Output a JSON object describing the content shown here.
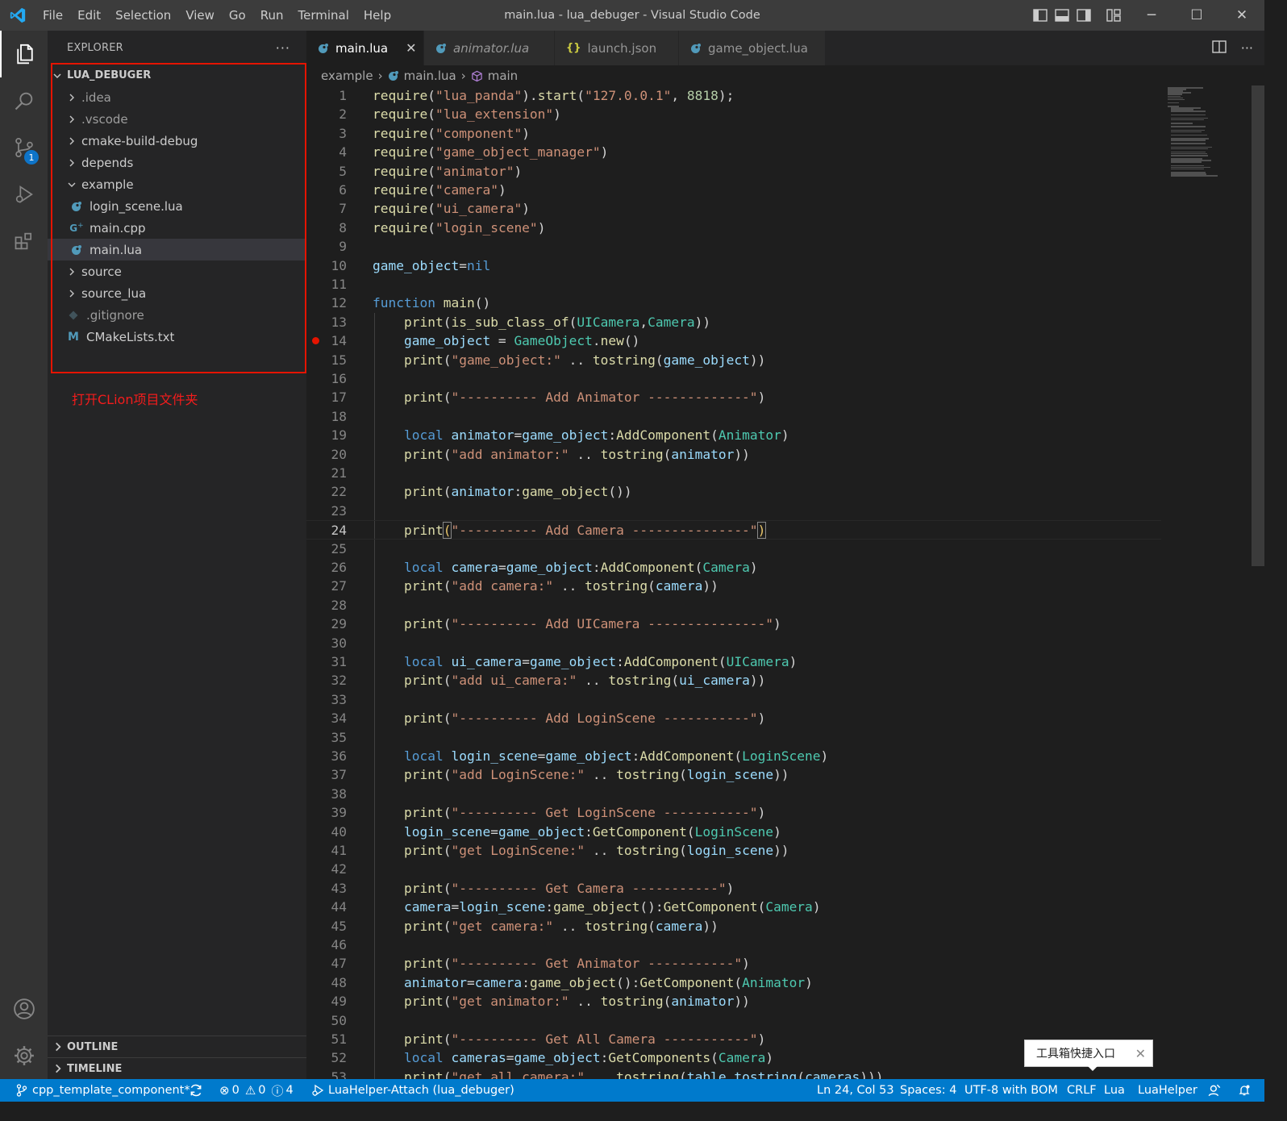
{
  "window": {
    "title": "main.lua - lua_debuger - Visual Studio Code",
    "menu": [
      "File",
      "Edit",
      "Selection",
      "View",
      "Go",
      "Run",
      "Terminal",
      "Help"
    ],
    "controls": {
      "minimize": "─",
      "maximize": "☐",
      "close": "✕"
    }
  },
  "activity_bar": {
    "scm_badge": "1"
  },
  "sidebar": {
    "title": "EXPLORER",
    "more": "···",
    "root": "LUA_DEBUGER",
    "items": [
      {
        "label": ".idea",
        "type": "folder",
        "depth": 1
      },
      {
        "label": ".vscode",
        "type": "folder",
        "depth": 1
      },
      {
        "label": "cmake-build-debug",
        "type": "folder",
        "depth": 1
      },
      {
        "label": "depends",
        "type": "folder",
        "depth": 1
      },
      {
        "label": "example",
        "type": "folder-open",
        "depth": 1
      },
      {
        "label": "login_scene.lua",
        "type": "lua",
        "depth": 2
      },
      {
        "label": "main.cpp",
        "type": "cpp",
        "depth": 2
      },
      {
        "label": "main.lua",
        "type": "lua",
        "depth": 2,
        "selected": true
      },
      {
        "label": "source",
        "type": "folder",
        "depth": 1
      },
      {
        "label": "source_lua",
        "type": "folder",
        "depth": 1
      },
      {
        "label": ".gitignore",
        "type": "git",
        "depth": 1
      },
      {
        "label": "CMakeLists.txt",
        "type": "cmake",
        "depth": 1
      }
    ],
    "annotation": "打开CLion项目文件夹",
    "outline": "OUTLINE",
    "timeline": "TIMELINE"
  },
  "tabs": [
    {
      "label": "main.lua",
      "active": true,
      "icon": "lua",
      "close": "✕"
    },
    {
      "label": "animator.lua",
      "italic": true,
      "icon": "lua"
    },
    {
      "label": "launch.json",
      "icon": "json"
    },
    {
      "label": "game_object.lua",
      "icon": "lua"
    }
  ],
  "breadcrumb": [
    "example",
    "main.lua",
    "main"
  ],
  "editor": {
    "current_line": 24,
    "breakpoint_line": 14,
    "lines": [
      [
        [
          "f",
          "require"
        ],
        [
          "w",
          "("
        ],
        [
          "s",
          "\"lua_panda\""
        ],
        [
          "w",
          ")."
        ],
        [
          "f",
          "start"
        ],
        [
          "w",
          "("
        ],
        [
          "s",
          "\"127.0.0.1\""
        ],
        [
          "w",
          ", "
        ],
        [
          "n",
          "8818"
        ],
        [
          "w",
          ");"
        ]
      ],
      [
        [
          "f",
          "require"
        ],
        [
          "w",
          "("
        ],
        [
          "s",
          "\"lua_extension\""
        ],
        [
          "w",
          ")"
        ]
      ],
      [
        [
          "f",
          "require"
        ],
        [
          "w",
          "("
        ],
        [
          "s",
          "\"component\""
        ],
        [
          "w",
          ")"
        ]
      ],
      [
        [
          "f",
          "require"
        ],
        [
          "w",
          "("
        ],
        [
          "s",
          "\"game_object_manager\""
        ],
        [
          "w",
          ")"
        ]
      ],
      [
        [
          "f",
          "require"
        ],
        [
          "w",
          "("
        ],
        [
          "s",
          "\"animator\""
        ],
        [
          "w",
          ")"
        ]
      ],
      [
        [
          "f",
          "require"
        ],
        [
          "w",
          "("
        ],
        [
          "s",
          "\"camera\""
        ],
        [
          "w",
          ")"
        ]
      ],
      [
        [
          "f",
          "require"
        ],
        [
          "w",
          "("
        ],
        [
          "s",
          "\"ui_camera\""
        ],
        [
          "w",
          ")"
        ]
      ],
      [
        [
          "f",
          "require"
        ],
        [
          "w",
          "("
        ],
        [
          "s",
          "\"login_scene\""
        ],
        [
          "w",
          ")"
        ]
      ],
      [],
      [
        [
          "v",
          "game_object"
        ],
        [
          "w",
          "="
        ],
        [
          "k",
          "nil"
        ]
      ],
      [],
      [
        [
          "k",
          "function "
        ],
        [
          "f",
          "main"
        ],
        [
          "w",
          "()"
        ]
      ],
      [
        [
          "w",
          "    "
        ],
        [
          "f",
          "print"
        ],
        [
          "w",
          "("
        ],
        [
          "f",
          "is_sub_class_of"
        ],
        [
          "w",
          "("
        ],
        [
          "t",
          "UICamera"
        ],
        [
          "w",
          ","
        ],
        [
          "t",
          "Camera"
        ],
        [
          "w",
          "))"
        ]
      ],
      [
        [
          "w",
          "    "
        ],
        [
          "v",
          "game_object"
        ],
        [
          "w",
          " = "
        ],
        [
          "t",
          "GameObject"
        ],
        [
          "w",
          "."
        ],
        [
          "f",
          "new"
        ],
        [
          "w",
          "()"
        ]
      ],
      [
        [
          "w",
          "    "
        ],
        [
          "f",
          "print"
        ],
        [
          "w",
          "("
        ],
        [
          "s",
          "\"game_object:\""
        ],
        [
          "w",
          " .. "
        ],
        [
          "f",
          "tostring"
        ],
        [
          "w",
          "("
        ],
        [
          "v",
          "game_object"
        ],
        [
          "w",
          "))"
        ]
      ],
      [],
      [
        [
          "w",
          "    "
        ],
        [
          "f",
          "print"
        ],
        [
          "w",
          "("
        ],
        [
          "s",
          "\"---------- Add Animator -------------\""
        ],
        [
          "w",
          ")"
        ]
      ],
      [],
      [
        [
          "w",
          "    "
        ],
        [
          "k",
          "local "
        ],
        [
          "v",
          "animator"
        ],
        [
          "w",
          "="
        ],
        [
          "v",
          "game_object"
        ],
        [
          "w",
          ":"
        ],
        [
          "f",
          "AddComponent"
        ],
        [
          "w",
          "("
        ],
        [
          "t",
          "Animator"
        ],
        [
          "w",
          ")"
        ]
      ],
      [
        [
          "w",
          "    "
        ],
        [
          "f",
          "print"
        ],
        [
          "w",
          "("
        ],
        [
          "s",
          "\"add animator:\""
        ],
        [
          "w",
          " .. "
        ],
        [
          "f",
          "tostring"
        ],
        [
          "w",
          "("
        ],
        [
          "v",
          "animator"
        ],
        [
          "w",
          "))"
        ]
      ],
      [],
      [
        [
          "w",
          "    "
        ],
        [
          "f",
          "print"
        ],
        [
          "w",
          "("
        ],
        [
          "v",
          "animator"
        ],
        [
          "w",
          ":"
        ],
        [
          "f",
          "game_object"
        ],
        [
          "w",
          "())"
        ]
      ],
      [],
      [
        [
          "w",
          "    "
        ],
        [
          "f",
          "print"
        ],
        [
          "hy",
          "("
        ],
        [
          "s",
          "\"---------- Add Camera ---------------\""
        ],
        [
          "hy",
          ")"
        ]
      ],
      [],
      [
        [
          "w",
          "    "
        ],
        [
          "k",
          "local "
        ],
        [
          "v",
          "camera"
        ],
        [
          "w",
          "="
        ],
        [
          "v",
          "game_object"
        ],
        [
          "w",
          ":"
        ],
        [
          "f",
          "AddComponent"
        ],
        [
          "w",
          "("
        ],
        [
          "t",
          "Camera"
        ],
        [
          "w",
          ")"
        ]
      ],
      [
        [
          "w",
          "    "
        ],
        [
          "f",
          "print"
        ],
        [
          "w",
          "("
        ],
        [
          "s",
          "\"add camera:\""
        ],
        [
          "w",
          " .. "
        ],
        [
          "f",
          "tostring"
        ],
        [
          "w",
          "("
        ],
        [
          "v",
          "camera"
        ],
        [
          "w",
          "))"
        ]
      ],
      [],
      [
        [
          "w",
          "    "
        ],
        [
          "f",
          "print"
        ],
        [
          "w",
          "("
        ],
        [
          "s",
          "\"---------- Add UICamera ---------------\""
        ],
        [
          "w",
          ")"
        ]
      ],
      [],
      [
        [
          "w",
          "    "
        ],
        [
          "k",
          "local "
        ],
        [
          "v",
          "ui_camera"
        ],
        [
          "w",
          "="
        ],
        [
          "v",
          "game_object"
        ],
        [
          "w",
          ":"
        ],
        [
          "f",
          "AddComponent"
        ],
        [
          "w",
          "("
        ],
        [
          "t",
          "UICamera"
        ],
        [
          "w",
          ")"
        ]
      ],
      [
        [
          "w",
          "    "
        ],
        [
          "f",
          "print"
        ],
        [
          "w",
          "("
        ],
        [
          "s",
          "\"add ui_camera:\""
        ],
        [
          "w",
          " .. "
        ],
        [
          "f",
          "tostring"
        ],
        [
          "w",
          "("
        ],
        [
          "v",
          "ui_camera"
        ],
        [
          "w",
          "))"
        ]
      ],
      [],
      [
        [
          "w",
          "    "
        ],
        [
          "f",
          "print"
        ],
        [
          "w",
          "("
        ],
        [
          "s",
          "\"---------- Add LoginScene -----------\""
        ],
        [
          "w",
          ")"
        ]
      ],
      [],
      [
        [
          "w",
          "    "
        ],
        [
          "k",
          "local "
        ],
        [
          "v",
          "login_scene"
        ],
        [
          "w",
          "="
        ],
        [
          "v",
          "game_object"
        ],
        [
          "w",
          ":"
        ],
        [
          "f",
          "AddComponent"
        ],
        [
          "w",
          "("
        ],
        [
          "t",
          "LoginScene"
        ],
        [
          "w",
          ")"
        ]
      ],
      [
        [
          "w",
          "    "
        ],
        [
          "f",
          "print"
        ],
        [
          "w",
          "("
        ],
        [
          "s",
          "\"add LoginScene:\""
        ],
        [
          "w",
          " .. "
        ],
        [
          "f",
          "tostring"
        ],
        [
          "w",
          "("
        ],
        [
          "v",
          "login_scene"
        ],
        [
          "w",
          "))"
        ]
      ],
      [],
      [
        [
          "w",
          "    "
        ],
        [
          "f",
          "print"
        ],
        [
          "w",
          "("
        ],
        [
          "s",
          "\"---------- Get LoginScene -----------\""
        ],
        [
          "w",
          ")"
        ]
      ],
      [
        [
          "w",
          "    "
        ],
        [
          "v",
          "login_scene"
        ],
        [
          "w",
          "="
        ],
        [
          "v",
          "game_object"
        ],
        [
          "w",
          ":"
        ],
        [
          "f",
          "GetComponent"
        ],
        [
          "w",
          "("
        ],
        [
          "t",
          "LoginScene"
        ],
        [
          "w",
          ")"
        ]
      ],
      [
        [
          "w",
          "    "
        ],
        [
          "f",
          "print"
        ],
        [
          "w",
          "("
        ],
        [
          "s",
          "\"get LoginScene:\""
        ],
        [
          "w",
          " .. "
        ],
        [
          "f",
          "tostring"
        ],
        [
          "w",
          "("
        ],
        [
          "v",
          "login_scene"
        ],
        [
          "w",
          "))"
        ]
      ],
      [],
      [
        [
          "w",
          "    "
        ],
        [
          "f",
          "print"
        ],
        [
          "w",
          "("
        ],
        [
          "s",
          "\"---------- Get Camera -----------\""
        ],
        [
          "w",
          ")"
        ]
      ],
      [
        [
          "w",
          "    "
        ],
        [
          "v",
          "camera"
        ],
        [
          "w",
          "="
        ],
        [
          "v",
          "login_scene"
        ],
        [
          "w",
          ":"
        ],
        [
          "f",
          "game_object"
        ],
        [
          "w",
          "():"
        ],
        [
          "f",
          "GetComponent"
        ],
        [
          "w",
          "("
        ],
        [
          "t",
          "Camera"
        ],
        [
          "w",
          ")"
        ]
      ],
      [
        [
          "w",
          "    "
        ],
        [
          "f",
          "print"
        ],
        [
          "w",
          "("
        ],
        [
          "s",
          "\"get camera:\""
        ],
        [
          "w",
          " .. "
        ],
        [
          "f",
          "tostring"
        ],
        [
          "w",
          "("
        ],
        [
          "v",
          "camera"
        ],
        [
          "w",
          "))"
        ]
      ],
      [],
      [
        [
          "w",
          "    "
        ],
        [
          "f",
          "print"
        ],
        [
          "w",
          "("
        ],
        [
          "s",
          "\"---------- Get Animator -----------\""
        ],
        [
          "w",
          ")"
        ]
      ],
      [
        [
          "w",
          "    "
        ],
        [
          "v",
          "animator"
        ],
        [
          "w",
          "="
        ],
        [
          "v",
          "camera"
        ],
        [
          "w",
          ":"
        ],
        [
          "f",
          "game_object"
        ],
        [
          "w",
          "():"
        ],
        [
          "f",
          "GetComponent"
        ],
        [
          "w",
          "("
        ],
        [
          "t",
          "Animator"
        ],
        [
          "w",
          ")"
        ]
      ],
      [
        [
          "w",
          "    "
        ],
        [
          "f",
          "print"
        ],
        [
          "w",
          "("
        ],
        [
          "s",
          "\"get animator:\""
        ],
        [
          "w",
          " .. "
        ],
        [
          "f",
          "tostring"
        ],
        [
          "w",
          "("
        ],
        [
          "v",
          "animator"
        ],
        [
          "w",
          "))"
        ]
      ],
      [],
      [
        [
          "w",
          "    "
        ],
        [
          "f",
          "print"
        ],
        [
          "w",
          "("
        ],
        [
          "s",
          "\"---------- Get All Camera -----------\""
        ],
        [
          "w",
          ")"
        ]
      ],
      [
        [
          "w",
          "    "
        ],
        [
          "k",
          "local "
        ],
        [
          "v",
          "cameras"
        ],
        [
          "w",
          "="
        ],
        [
          "v",
          "game_object"
        ],
        [
          "w",
          ":"
        ],
        [
          "f",
          "GetComponents"
        ],
        [
          "w",
          "("
        ],
        [
          "t",
          "Camera"
        ],
        [
          "w",
          ")"
        ]
      ],
      [
        [
          "w",
          "    "
        ],
        [
          "f",
          "print"
        ],
        [
          "w",
          "("
        ],
        [
          "s",
          "\"get all camera:\""
        ],
        [
          "w",
          " .. "
        ],
        [
          "f",
          "tostring"
        ],
        [
          "w",
          "("
        ],
        [
          "v",
          "table_tostring"
        ],
        [
          "w",
          "("
        ],
        [
          "v",
          "cameras"
        ],
        [
          "w",
          ")))"
        ]
      ]
    ]
  },
  "toast": {
    "text": "工具箱快捷入口",
    "close": "✕"
  },
  "statusbar": {
    "branch": "cpp_template_component*",
    "errors": "0",
    "warnings": "0",
    "info": "4",
    "debug": "LuaHelper-Attach (lua_debuger)",
    "position": "Ln 24, Col 53",
    "spaces": "Spaces: 4",
    "encoding": "UTF-8 with BOM",
    "eol": "CRLF",
    "language": "Lua",
    "extension": "LuaHelper"
  },
  "colors": {
    "accent": "#007acc",
    "keyword": "#569cd6",
    "string": "#ce9178",
    "function": "#dcdcaa",
    "type": "#4ec9b0",
    "variable": "#9cdcfe",
    "number": "#b5cea8",
    "breakpoint": "#e51400",
    "annotation": "#f41c1c"
  }
}
